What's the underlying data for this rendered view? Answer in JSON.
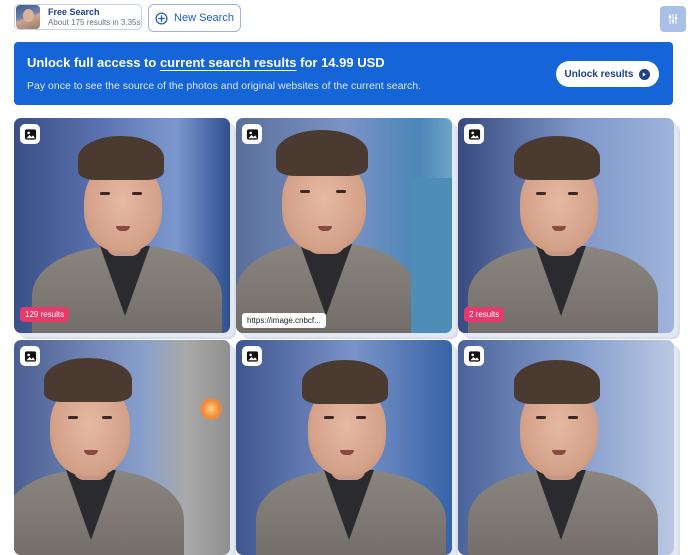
{
  "search_chip": {
    "title": "Free Search",
    "subtitle": "About 175 results in 3.35s"
  },
  "new_search": {
    "label": "New Search",
    "icon": "plus-circle-icon"
  },
  "filter_button": {
    "icon": "sliders-icon"
  },
  "banner": {
    "title_prefix": "Unlock full access to ",
    "title_link": "current search results",
    "title_suffix": " for 14.99 USD",
    "subtitle": "Pay once to see the source of the photos and original websites of the current search.",
    "button_label": "Unlock results",
    "button_icon": "arrow-right-circle-icon",
    "background_color": "#1565d8"
  },
  "results": [
    {
      "icon": "image-icon",
      "badge": "129 results"
    },
    {
      "icon": "image-icon",
      "url": "https://image.cnbcf..."
    },
    {
      "icon": "image-icon",
      "badge": "2 results"
    },
    {
      "icon": "image-icon"
    },
    {
      "icon": "image-icon"
    },
    {
      "icon": "image-icon"
    }
  ],
  "colors": {
    "accent": "#1565d8",
    "badge": "#e8396b",
    "filter_button": "#a9c0e6"
  }
}
